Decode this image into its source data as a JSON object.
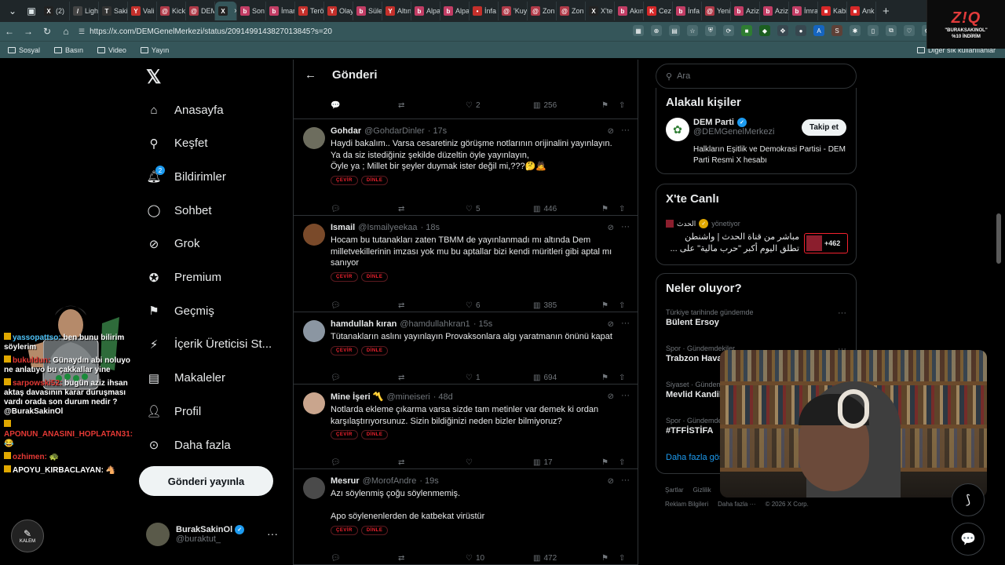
{
  "browser": {
    "tabs": [
      {
        "label": "(2) ",
        "fav": "X",
        "color": "#222"
      },
      {
        "label": "Ligh",
        "fav": "/",
        "color": "#444"
      },
      {
        "label": "Saki",
        "fav": "T",
        "color": "#333"
      },
      {
        "label": "Vali",
        "fav": "Y",
        "color": "#c4302b"
      },
      {
        "label": "Kick",
        "fav": "@",
        "color": "#b03a48"
      },
      {
        "label": "DEM",
        "fav": "@",
        "color": "#b03a48"
      },
      {
        "label": "",
        "fav": "X",
        "color": "#222",
        "active": true
      },
      {
        "label": "Son",
        "fav": "b",
        "color": "#c23d65"
      },
      {
        "label": "İmar",
        "fav": "b",
        "color": "#c23d65"
      },
      {
        "label": "Terö",
        "fav": "Y",
        "color": "#c4302b"
      },
      {
        "label": "Olay",
        "fav": "Y",
        "color": "#c4302b"
      },
      {
        "label": "Süle",
        "fav": "b",
        "color": "#c23d65"
      },
      {
        "label": "Altın",
        "fav": "Y",
        "color": "#c4302b"
      },
      {
        "label": "Alpa",
        "fav": "b",
        "color": "#c23d65"
      },
      {
        "label": "Alpa",
        "fav": "b",
        "color": "#c23d65"
      },
      {
        "label": "İnfa",
        "fav": "•",
        "color": "#c4302b"
      },
      {
        "label": "'Kuy",
        "fav": "@",
        "color": "#b03a48"
      },
      {
        "label": "Zon",
        "fav": "@",
        "color": "#b03a48"
      },
      {
        "label": "Zon",
        "fav": "@",
        "color": "#b03a48"
      },
      {
        "label": "X'te",
        "fav": "X",
        "color": "#222"
      },
      {
        "label": "Akın",
        "fav": "b",
        "color": "#c23d65"
      },
      {
        "label": "Cez",
        "fav": "K",
        "color": "#d62828"
      },
      {
        "label": "İnfa",
        "fav": "b",
        "color": "#c23d65"
      },
      {
        "label": "Yeni",
        "fav": "@",
        "color": "#b03a48"
      },
      {
        "label": "Aziz",
        "fav": "b",
        "color": "#c23d65"
      },
      {
        "label": "Aziz",
        "fav": "b",
        "color": "#c23d65"
      },
      {
        "label": "İmra",
        "fav": "b",
        "color": "#c23d65"
      },
      {
        "label": "Kabi",
        "fav": "■",
        "color": "#d62828"
      },
      {
        "label": "Ank",
        "fav": "■",
        "color": "#d62828"
      }
    ],
    "url": "https://x.com/DEMGenelMerkezi/status/2091499143827013845?s=20",
    "bookmarks": [
      "Sosyal",
      "Basın",
      "Video",
      "Yayın"
    ],
    "other_bookmarks": "Diğer sık kullanılanlar",
    "promo": {
      "logo": "Z!Q",
      "line1": "\"BURAKSAKINOL\"",
      "line2": "%10 İNDİRİM"
    }
  },
  "nav": {
    "items": [
      {
        "label": "Anasayfa",
        "icon": "home-icon"
      },
      {
        "label": "Keşfet",
        "icon": "search-icon"
      },
      {
        "label": "Bildirimler",
        "icon": "bell-icon",
        "badge": "2"
      },
      {
        "label": "Sohbet",
        "icon": "chat-icon"
      },
      {
        "label": "Grok",
        "icon": "grok-icon"
      },
      {
        "label": "Premium",
        "icon": "premium-icon"
      },
      {
        "label": "Geçmiş",
        "icon": "bookmark-icon"
      },
      {
        "label": "İçerik Üreticisi St...",
        "icon": "lightning-icon"
      },
      {
        "label": "Makaleler",
        "icon": "article-icon"
      },
      {
        "label": "Profil",
        "icon": "person-icon"
      },
      {
        "label": "Daha fazla",
        "icon": "more-circle-icon"
      }
    ],
    "post_button": "Gönderi yayınla",
    "profile": {
      "name": "BurakSakinOl",
      "handle": "@buraktut_"
    }
  },
  "timeline": {
    "title": "Gönderi",
    "top_actions": {
      "likes": "2",
      "views": "256"
    },
    "chip_translate": "ÇEVİR",
    "chip_listen": "DİNLE",
    "posts": [
      {
        "name": "Gohdar",
        "handle": "@GohdarDinler",
        "time": "· 17s",
        "text": "Haydi bakalım.. Varsa cesaretiniz görüşme notlarının orijinalini yayınlayın.\nYa da siz istediğiniz şekilde düzeltin öyle yayınlayın,\nÖyle ya ; Millet bir şeyler duymak ister değil mi,???🤔🙇",
        "replies": "",
        "reposts": "",
        "likes": "5",
        "views": "446",
        "avatar": "#6d6d5e"
      },
      {
        "name": "Ismail",
        "handle": "@Ismailyeekaa",
        "time": "· 18s",
        "text": "Hocam bu tutanakları zaten TBMM de yayınlanmadı mı altında Dem milletvekillerinin imzası yok mu bu aptallar bizi kendi müritleri gibi aptal mı sanıyor",
        "replies": "",
        "reposts": "",
        "likes": "6",
        "views": "385",
        "avatar": "#7a4a2a"
      },
      {
        "name": "hamdullah kıran",
        "handle": "@hamdullahkran1",
        "time": "· 15s",
        "text": "Tütanakların aslını yayınlayın   Provaksonlara  algı yaratmanın önünü kapat",
        "replies": "",
        "reposts": "",
        "likes": "1",
        "views": "694",
        "avatar": "#8b96a2"
      },
      {
        "name": "Mine İşeri 〽️",
        "handle": "@mineiseri",
        "time": "· 48d",
        "text": "Notlarda ekleme çıkarma varsa sizde tam metinler var demek ki ordan karşılaştırıyorsunuz. Sizin bildiğinizi neden bizler bilmiyoruz?",
        "replies": "",
        "reposts": "",
        "likes": "",
        "views": "17",
        "avatar": "#c9a58d"
      },
      {
        "name": "Mesrur",
        "handle": "@MorofAndre",
        "time": "· 19s",
        "text": "Azı söylenmiş çoğu söylenmemiş.\n\nApo söylenenlerden de katbekat virüstür",
        "replies": "",
        "reposts": "",
        "likes": "10",
        "views": "472",
        "avatar": "#4a4a4a"
      }
    ]
  },
  "sidebar": {
    "search_placeholder": "Ara",
    "related_title": "Alakalı kişiler",
    "related": {
      "name": "DEM Parti",
      "handle": "@DEMGenelMerkezi",
      "bio": "Halkların Eşitlik ve Demokrasi Partisi - DEM Parti Resmi X hesabı",
      "follow": "Takip et"
    },
    "live_title": "X'te Canlı",
    "live": {
      "host": "الحدث",
      "host_suffix": "yönetiyor",
      "text": "مباشر من قناة الحدث | واشنطن تطلق اليوم أكبر \"حرب مالية\" على ...",
      "count": "+462"
    },
    "trends_title": "Neler oluyor?",
    "trends": [
      {
        "cat": "Türkiye tarihinde gündemde",
        "title": "Bülent Ersoy"
      },
      {
        "cat": "Spor · Gündemdekiler",
        "title": "Trabzon Havalir"
      },
      {
        "cat": "Siyaset · Gündem",
        "title": "Mevlid Kandil"
      },
      {
        "cat": "Spor · Gündemde",
        "title": "#TFFİSTİFA"
      }
    ],
    "show_more": "Daha fazla gös",
    "footer": [
      "Şartlar",
      "Gizlilik"
    ],
    "footer2": [
      "Reklam Bilgileri",
      "Daha fazla ···",
      "© 2026 X Corp."
    ]
  },
  "stream": {
    "chat": [
      {
        "user": "yassopattso:",
        "msg": "ben bunu bilirim söylerim",
        "color": "#4fc3f7"
      },
      {
        "user": "bukuldun:",
        "msg": "Günaydın abi noluyo ne anlatıyo bu çakkallar yine",
        "color": "#e53935"
      },
      {
        "user": "sarpowski52:",
        "msg": "bugün aziz ihsan aktaş davasının karar duruşması vardı orada son durum nedir ? @BurakSakinOl",
        "color": "#e53935"
      },
      {
        "user": "APONUN_ANASINI_HOPLATAN31:",
        "msg": "😂",
        "color": "#e53935"
      },
      {
        "user": "ozhimen:",
        "msg": "🐢",
        "color": "#e53935"
      },
      {
        "user": "APOYU_KIRBACLAYAN:",
        "msg": "🐴",
        "color": "#ffffff"
      }
    ],
    "kalem": "KALEM"
  }
}
